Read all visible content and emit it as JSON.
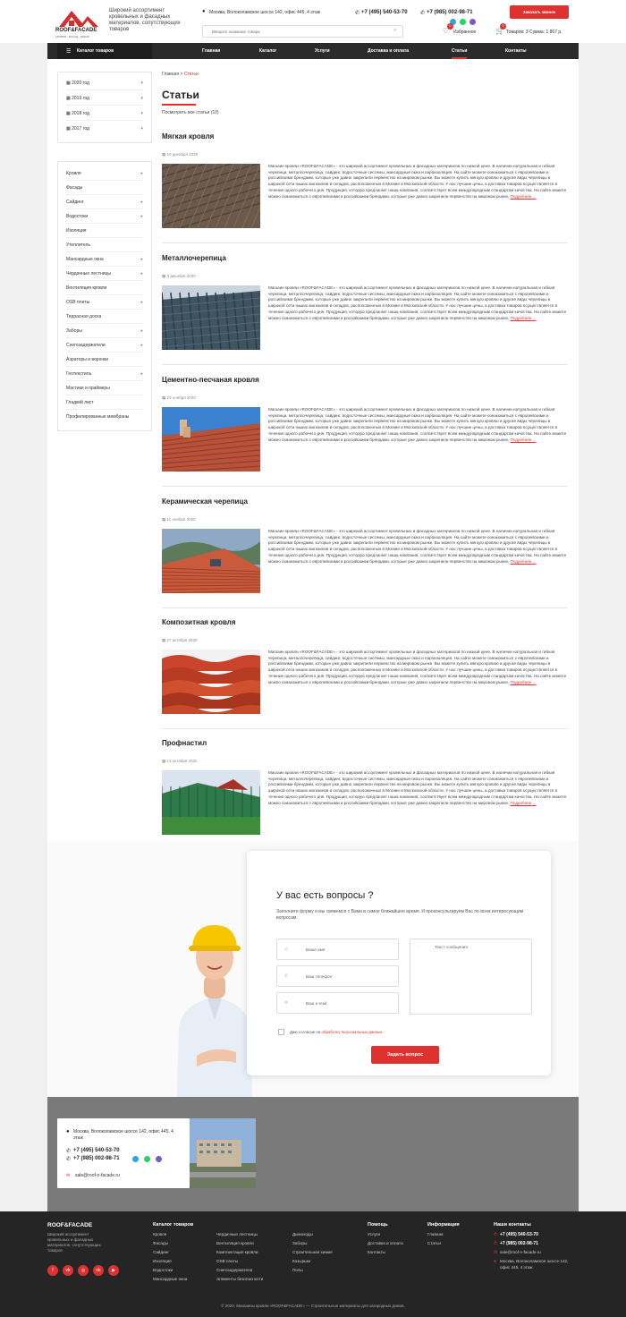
{
  "header": {
    "logo_name": "ROOF&FACADE",
    "logo_sub": "КРОВЛЯ · ФАСАД · ЗАБОР",
    "tagline": "Широкий ассортимент кровельных и фасадных материалов, сопутствующих товаров",
    "address": "Москва, Волоколамское шоссе 142, офис 445, 4 этаж",
    "phone1": "+7 (495) 540-53-70",
    "phone2": "+7 (985) 002-98-71",
    "search_placeholder": "Введите название товара",
    "call_button": "Заказать звонок",
    "favorites_label": "Избранное",
    "favorites_count": "0",
    "cart_label": "Товаров: 3 Сумма: 1 867 р.",
    "cart_count": "3"
  },
  "nav": {
    "catalog": "Каталог товаров",
    "items": [
      "Главная",
      "Каталог",
      "Услуги",
      "Доставка и оплата",
      "Статьи",
      "Контакты"
    ],
    "active": "Статьи"
  },
  "sidebar": {
    "years": [
      "2020 год",
      "2019 год",
      "2018 год",
      "2017 год"
    ],
    "categories": [
      {
        "label": "Кровля",
        "arrow": true
      },
      {
        "label": "Фасады",
        "arrow": false
      },
      {
        "label": "Сайдинг",
        "arrow": true
      },
      {
        "label": "Водостоки",
        "arrow": true
      },
      {
        "label": "Изоляция",
        "arrow": false
      },
      {
        "label": "Утеплитель",
        "arrow": false
      },
      {
        "label": "Мансардные окна",
        "arrow": true
      },
      {
        "label": "Чердачные лестницы",
        "arrow": true
      },
      {
        "label": "Вентиляция кровли",
        "arrow": false
      },
      {
        "label": "OSB плиты",
        "arrow": true
      },
      {
        "label": "Террасная доска",
        "arrow": false
      },
      {
        "label": "Заборы",
        "arrow": true
      },
      {
        "label": "Снегозадержатели",
        "arrow": true
      },
      {
        "label": "Аэраторы и воронки",
        "arrow": false
      },
      {
        "label": "Геотекстиль",
        "arrow": true
      },
      {
        "label": "Мастики и праймеры",
        "arrow": false
      },
      {
        "label": "Гладкий лист",
        "arrow": false
      },
      {
        "label": "Профилированные мембраны",
        "arrow": false
      }
    ]
  },
  "breadcrumb": {
    "home": "Главная",
    "sep": " > ",
    "current": "Статьи"
  },
  "page": {
    "title": "Статьи",
    "view_all": "Посмотреть все статьи (10)"
  },
  "articles": [
    {
      "title": "Мягкая кровля",
      "date": "10 декабря 2020"
    },
    {
      "title": "Металлочерепица",
      "date": "3 декабря 2020"
    },
    {
      "title": "Цементно-песчаная кровля",
      "date": "23 ноября 2020"
    },
    {
      "title": "Керамическая черепица",
      "date": "11 ноября 2020"
    },
    {
      "title": "Композитная кровля",
      "date": "27 октября 2020"
    },
    {
      "title": "Профнастил",
      "date": "13 октября 2020"
    }
  ],
  "article_text": "Магазин кровли «ROOF&FACADE» - это широкий ассортимент кровельных и фасадных материалов по низкой цене. В наличии натуральная и гибкая черепица, металлочерепица, сайдинг, водосточные системы, мансардные окна и пароизоляция. На сайте можете ознакомиться с европейскими и российскими брендами, которые уже давно закрепили первенство на мировом рынке. Вы можете купить мягкую кровлю и другие виды черепицы в широкой сети наших магазинов и складов, расположенных в Москве и Московской области. У нас лучшие цены, а доставка товаров осуществляется в течение одного рабочего дня. Продукция, которую предлагает наша компания, соответствует всем международным стандартам качества. На сайте можете можно ознакомиться с европейскими и российскими брендами, которые уже давно закрепили первенство на мировом рынке.",
  "more_label": "Подробнее ...",
  "form": {
    "title": "У вас есть вопросы ?",
    "desc": "Заполните форму и мы свяжемся с Вами в самое ближайшее время. И проконсультируем Вас по всем интересующим вопросам.",
    "name_ph": "Ваше имя",
    "phone_ph": "Ваш телефон",
    "email_ph": "Ваш e-mail",
    "message_ph": "Текст сообщения",
    "agree_text": "Даю согласие на",
    "agree_link": "обработку персональных данных",
    "submit": "Задать вопрос"
  },
  "contacts": {
    "address": "Москва, Волоколамское шоссе 142, офис 445, 4 этаж",
    "phone1": "+7 (495) 540-53-70",
    "phone2": "+7 (985) 002-98-71",
    "email": "sale@roof-n-facade.ru"
  },
  "footer": {
    "logo": "ROOF&FACADE",
    "tagline": "Широкий ассортимент кровельных и фасадных материалов, сопутствующих товаров",
    "catalog_head": "Каталог товаров",
    "col1": [
      "Кровля",
      "Фасады",
      "Сайдинг",
      "Изоляция",
      "Водостоки",
      "Мансардные окна"
    ],
    "col2": [
      "Чердачные лестницы",
      "Вентиляция кровли",
      "Комплектация кровли",
      "OSB плиты",
      "Снегозадержатели",
      "Элементы безопасности"
    ],
    "col3": [
      "Дымоходы",
      "Заборы",
      "Строительная химия",
      "Козырьки",
      "Полы"
    ],
    "help_head": "Помощь",
    "help": [
      "Услуги",
      "Доставка и оплата",
      "Контакты"
    ],
    "info_head": "Информация",
    "info": [
      "Главная",
      "Статьи"
    ],
    "contacts_head": "Наши контакты",
    "phone1": "+7 (495) 540-53-70",
    "phone2": "+7 (985) 002-98-71",
    "email": "sale@roof-n-facade.ru",
    "address": "Москва, Волоколамское шоссе 142, офис 445, 4 этаж",
    "copyright": "© 2020. Магазины кровли «ROOF&FACADE» — Строительные материалы для загородных домов."
  },
  "colors": {
    "accent": "#e03131",
    "nav_bg": "#2b2b2b",
    "footer_bg": "#252525"
  }
}
